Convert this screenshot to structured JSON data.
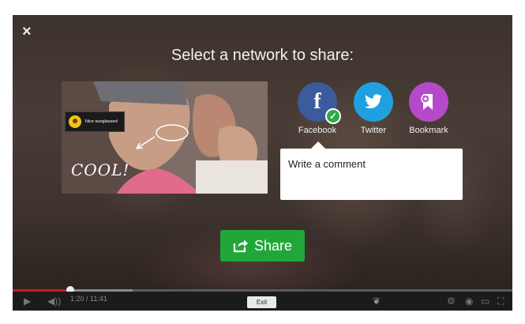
{
  "overlay": {
    "title": "Select a network to share:",
    "close_icon": "×"
  },
  "preview": {
    "sticker_text": "Nice sunglasses!",
    "handwriting": "COOL!"
  },
  "networks": [
    {
      "label": "Facebook",
      "icon": "facebook-icon",
      "color": "#3b5b9c",
      "selected": true
    },
    {
      "label": "Twitter",
      "icon": "twitter-icon",
      "color": "#1fa1e0",
      "selected": false
    },
    {
      "label": "Bookmark",
      "icon": "bookmark-icon",
      "color": "#b44ac9",
      "selected": false
    }
  ],
  "comment": {
    "placeholder": "Write a comment"
  },
  "share_button": {
    "label": "Share",
    "color": "#21a739"
  },
  "player": {
    "time": "1:20 / 11:41",
    "exit_label": "Exit",
    "progress": 0.115,
    "buffered": 0.24,
    "progress_color": "#cc1a1a"
  }
}
